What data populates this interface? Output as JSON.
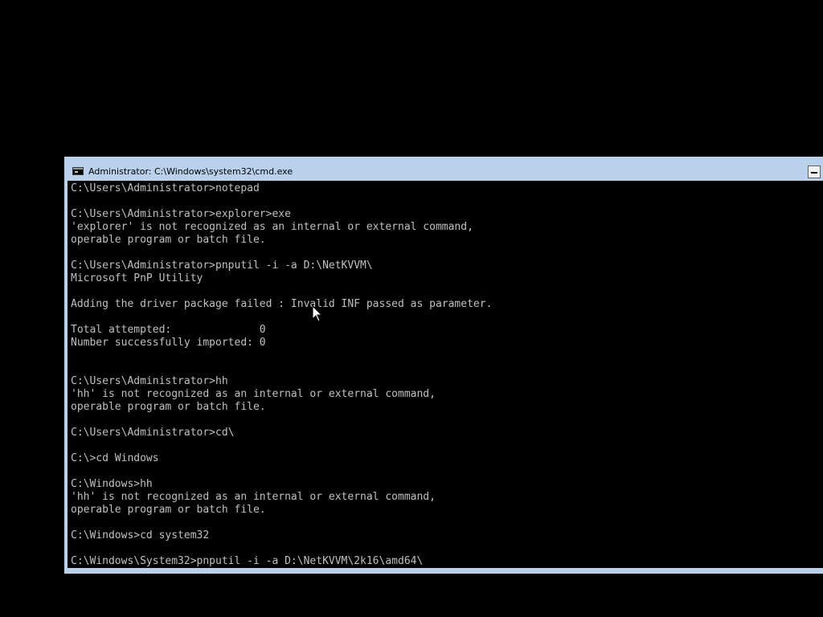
{
  "window": {
    "title": "Administrator: C:\\Windows\\system32\\cmd.exe",
    "icon": "cmd-console-icon",
    "minimize_icon": "minimize-icon"
  },
  "console": {
    "lines": [
      "C:\\Users\\Administrator>notepad",
      "",
      "C:\\Users\\Administrator>explorer>exe",
      "'explorer' is not recognized as an internal or external command,",
      "operable program or batch file.",
      "",
      "C:\\Users\\Administrator>pnputil -i -a D:\\NetKVVM\\",
      "Microsoft PnP Utility",
      "",
      "Adding the driver package failed : Invalid INF passed as parameter.",
      "",
      "Total attempted:              0",
      "Number successfully imported: 0",
      "",
      "",
      "C:\\Users\\Administrator>hh",
      "'hh' is not recognized as an internal or external command,",
      "operable program or batch file.",
      "",
      "C:\\Users\\Administrator>cd\\",
      "",
      "C:\\>cd Windows",
      "",
      "C:\\Windows>hh",
      "'hh' is not recognized as an internal or external command,",
      "operable program or batch file.",
      "",
      "C:\\Windows>cd system32",
      "",
      "C:\\Windows\\System32>pnputil -i -a D:\\NetKVVM\\2k16\\amd64\\"
    ]
  },
  "colors": {
    "desktop": "#000000",
    "window_frame": "#b9d1ea",
    "console_background": "#000000",
    "console_text": "#c0c0c0"
  },
  "cursor_icon": "arrow-pointer-icon"
}
